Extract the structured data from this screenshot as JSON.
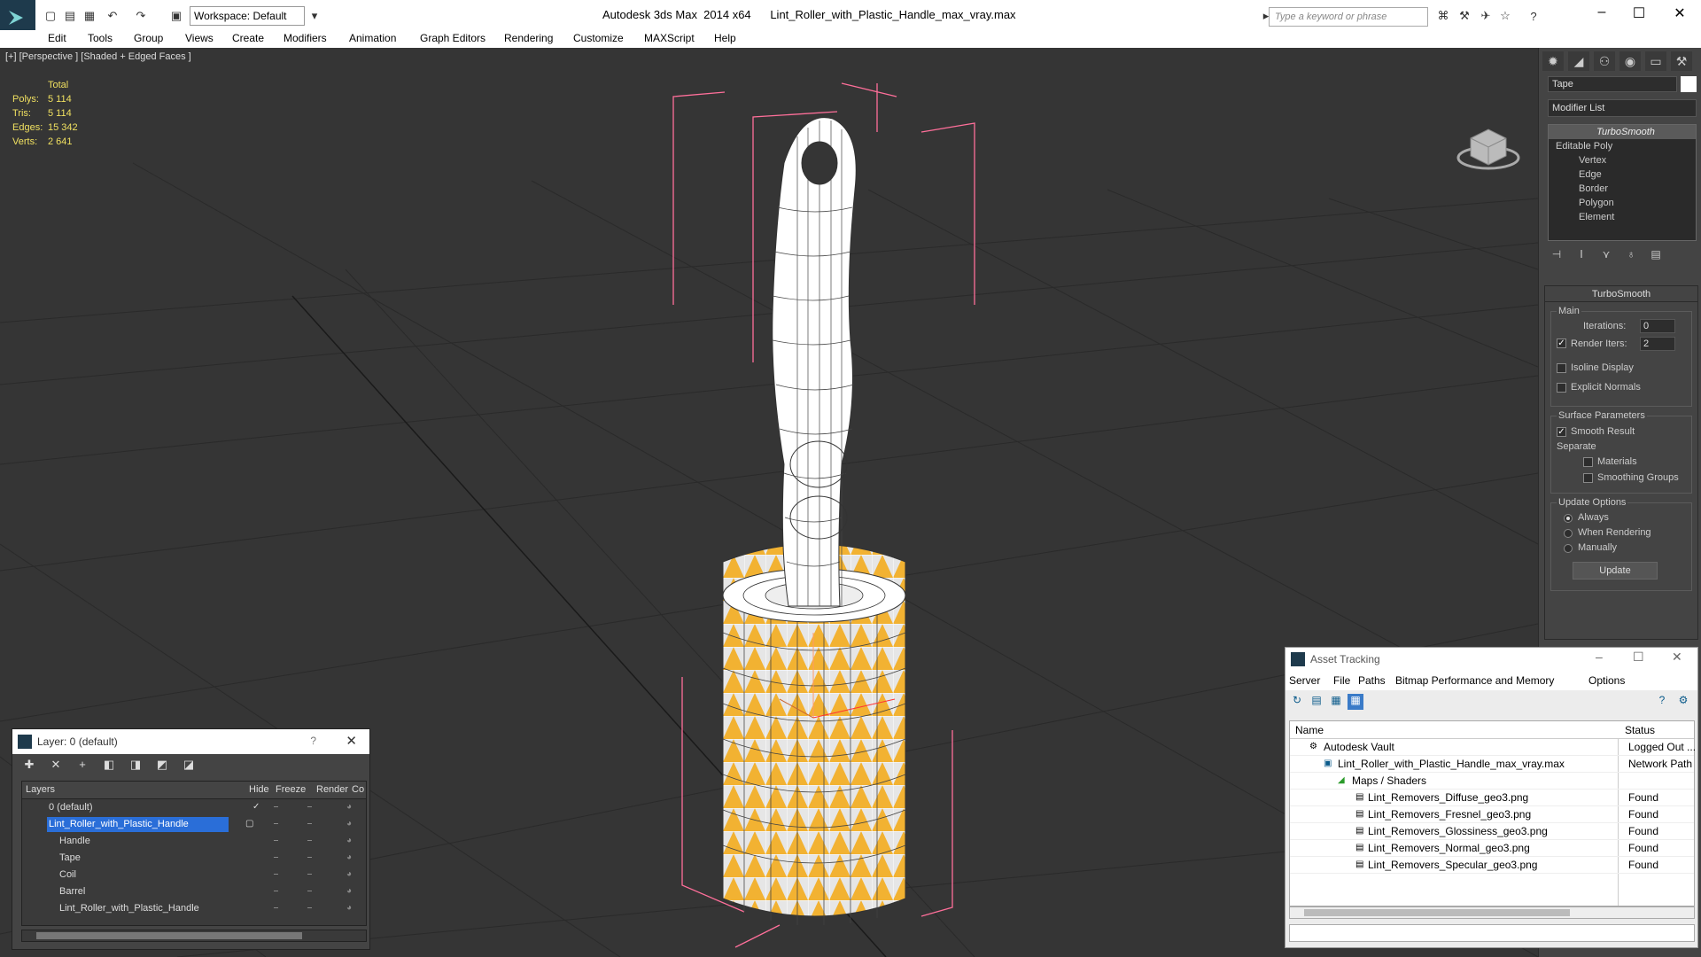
{
  "app": {
    "window_title": "Autodesk 3ds Max  2014 x64      Lint_Roller_with_Plastic_Handle_max_vray.max",
    "workspace": "Workspace: Default",
    "search_placeholder": "Type a keyword or phrase"
  },
  "menu": [
    "Edit",
    "Tools",
    "Group",
    "Views",
    "Create",
    "Modifiers",
    "Animation",
    "Graph Editors",
    "Rendering",
    "Customize",
    "MAXScript",
    "Help"
  ],
  "viewport": {
    "label": "[+] [Perspective ] [Shaded + Edged Faces ]",
    "stats": {
      "header": "Total",
      "rows": [
        {
          "k": "Polys:",
          "v": "5 114"
        },
        {
          "k": "Tris:",
          "v": "5 114"
        },
        {
          "k": "Edges:",
          "v": "15 342"
        },
        {
          "k": "Verts:",
          "v": "2 641"
        }
      ]
    }
  },
  "command_panel": {
    "object_name": "Tape",
    "modifier_list": "Modifier List",
    "stack": [
      "TurboSmooth",
      "Editable Poly",
      "Vertex",
      "Edge",
      "Border",
      "Polygon",
      "Element"
    ],
    "rollout_title": "TurboSmooth",
    "main_label": "Main",
    "iterations_label": "Iterations:",
    "iterations_value": "0",
    "render_iters_label": "Render Iters:",
    "render_iters_value": "2",
    "isoline_label": "Isoline Display",
    "explicit_label": "Explicit Normals",
    "surface_label": "Surface Parameters",
    "smooth_label": "Smooth Result",
    "separate_label": "Separate",
    "materials_label": "Materials",
    "smoothing_label": "Smoothing Groups",
    "update_label": "Update Options",
    "always_label": "Always",
    "when_label": "When Rendering",
    "manually_label": "Manually",
    "update_button": "Update"
  },
  "layer_dialog": {
    "title": "Layer: 0 (default)",
    "help": "?",
    "headers": {
      "layers": "Layers",
      "hide": "Hide",
      "freeze": "Freeze",
      "render": "Render",
      "c": "Co"
    },
    "rows": [
      {
        "name": "0 (default)"
      },
      {
        "name": "Lint_Roller_with_Plastic_Handle"
      },
      {
        "name": "Handle"
      },
      {
        "name": "Tape"
      },
      {
        "name": "Coil"
      },
      {
        "name": "Barrel"
      },
      {
        "name": "Lint_Roller_with_Plastic_Handle"
      }
    ]
  },
  "asset_dialog": {
    "title": "Asset Tracking",
    "menu": [
      "Server",
      "File",
      "Paths",
      "Bitmap Performance and Memory",
      "Options"
    ],
    "headers": {
      "name": "Name",
      "status": "Status"
    },
    "rows": [
      {
        "name": "Autodesk Vault",
        "status": "Logged Out ..."
      },
      {
        "name": "Lint_Roller_with_Plastic_Handle_max_vray.max",
        "status": "Network Path"
      },
      {
        "name": "Maps / Shaders",
        "status": ""
      },
      {
        "name": "Lint_Removers_Diffuse_geo3.png",
        "status": "Found"
      },
      {
        "name": "Lint_Removers_Fresnel_geo3.png",
        "status": "Found"
      },
      {
        "name": "Lint_Removers_Glossiness_geo3.png",
        "status": "Found"
      },
      {
        "name": "Lint_Removers_Normal_geo3.png",
        "status": "Found"
      },
      {
        "name": "Lint_Removers_Specular_geo3.png",
        "status": "Found"
      }
    ]
  },
  "colors": {
    "viewport_bg": "#353535",
    "stats_text": "#f0e060",
    "selection_blue": "#2a6ed8",
    "tape_yellow": "#f2b232",
    "bbox_pink": "#ff6f9a"
  }
}
